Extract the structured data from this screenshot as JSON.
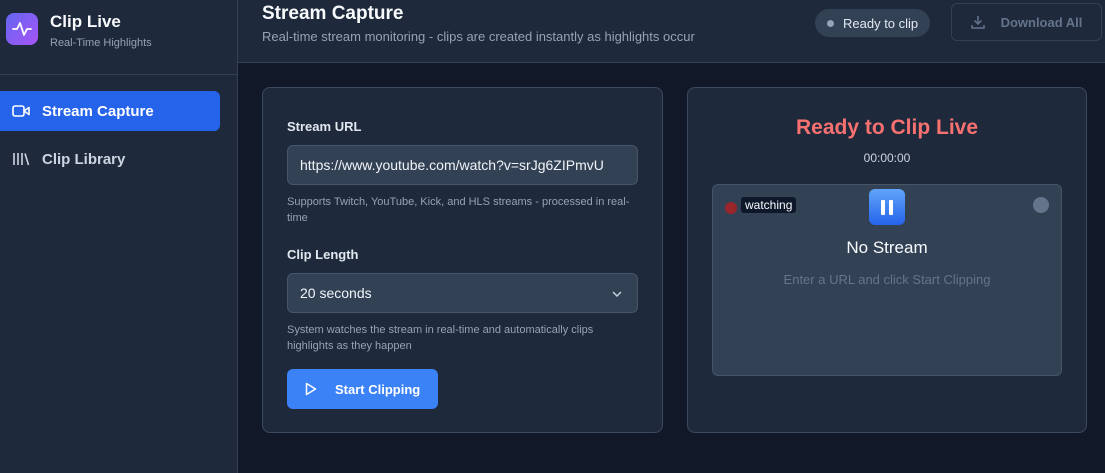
{
  "app": {
    "title": "Clip Live",
    "subtitle": "Real-Time Highlights",
    "logo_icon": "pulse-icon",
    "accent": "#2563eb"
  },
  "sidebar": {
    "items": [
      {
        "label": "Stream Capture",
        "icon": "video-camera-icon",
        "active": true
      },
      {
        "label": "Clip Library",
        "icon": "library-icon",
        "active": false
      }
    ]
  },
  "header": {
    "title": "Stream Capture",
    "subtitle": "Real-time stream monitoring - clips are created instantly as highlights occur",
    "status": "Ready to clip",
    "download_label": "Download All"
  },
  "form": {
    "url_label": "Stream URL",
    "url_value": "https://www.youtube.com/watch?v=srJg6ZIPmvU",
    "url_hint": "Supports Twitch, YouTube, Kick, and HLS streams - processed in real-time",
    "length_label": "Clip Length",
    "length_value": "20 seconds",
    "length_hint": "System watches the stream in real-time and automatically clips highlights as they happen",
    "start_label": "Start Clipping"
  },
  "preview": {
    "title": "Ready to Clip Live",
    "title_color": "#f87171",
    "timer": "00:00:00",
    "badge": "watching",
    "no_stream": "No Stream",
    "no_stream_hint": "Enter a URL and click Start Clipping"
  }
}
